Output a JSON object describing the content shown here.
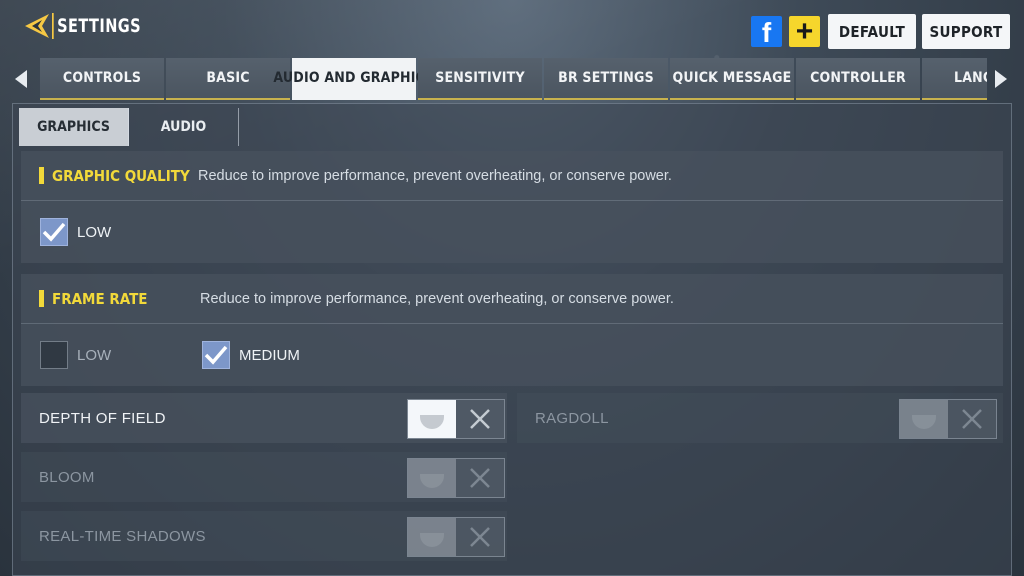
{
  "header": {
    "title": "SETTINGS",
    "facebook_label": "f",
    "plus_label": "+",
    "default_label": "DEFAULT",
    "support_label": "SUPPORT"
  },
  "tabs": [
    {
      "label": "CONTROLS",
      "active": false
    },
    {
      "label": "BASIC",
      "active": false
    },
    {
      "label": "AUDIO AND GRAPHICS",
      "active": true
    },
    {
      "label": "SENSITIVITY",
      "active": false
    },
    {
      "label": "BR SETTINGS",
      "active": false
    },
    {
      "label": "QUICK MESSAGE",
      "active": false
    },
    {
      "label": "CONTROLLER",
      "active": false
    },
    {
      "label": "LANGUAGE",
      "active": false
    }
  ],
  "subtabs": [
    {
      "label": "GRAPHICS",
      "active": true
    },
    {
      "label": "AUDIO",
      "active": false
    }
  ],
  "graphic_quality": {
    "title": "GRAPHIC QUALITY",
    "description": "Reduce to improve performance, prevent overheating, or conserve power.",
    "options": [
      {
        "label": "LOW",
        "checked": true
      }
    ]
  },
  "frame_rate": {
    "title": "FRAME RATE",
    "description": "Reduce to improve performance, prevent overheating, or conserve power.",
    "options": [
      {
        "label": "LOW",
        "checked": false
      },
      {
        "label": "MEDIUM",
        "checked": true
      }
    ]
  },
  "toggles": [
    {
      "label": "DEPTH OF FIELD",
      "enabled": true
    },
    {
      "label": "RAGDOLL",
      "enabled": false
    },
    {
      "label": "BLOOM",
      "enabled": false
    },
    {
      "label": "REAL-TIME SHADOWS",
      "enabled": false
    }
  ],
  "colors": {
    "accent_yellow": "#f2d93a",
    "facebook_blue": "#1877f2",
    "checkbox_blue": "#7d97c9"
  }
}
